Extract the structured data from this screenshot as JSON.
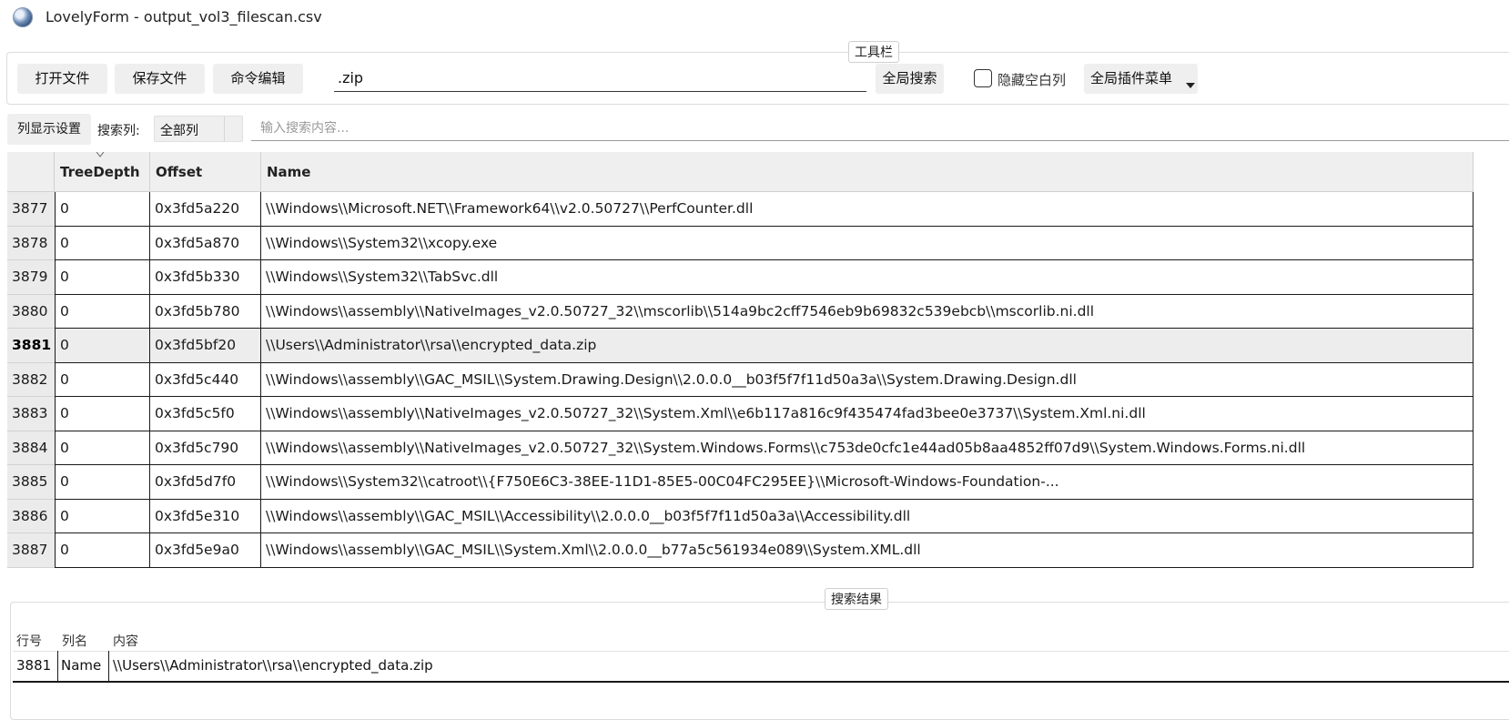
{
  "window": {
    "title": "LovelyForm - output_vol3_filescan.csv",
    "app_icon": "globe-icon"
  },
  "toolbar": {
    "legend": "工具栏",
    "open_file": "打开文件",
    "save_file": "保存文件",
    "command_edit": "命令编辑",
    "search_value": ".zip",
    "global_search": "全局搜索",
    "hide_blank_columns": "隐藏空白列",
    "hide_blank_checked": false,
    "global_plugin_menu": "全局插件菜单"
  },
  "filter": {
    "column_settings": "列显示设置",
    "search_column_label": "搜索列:",
    "search_column_value": "全部列",
    "search_placeholder": "输入搜索内容..."
  },
  "table": {
    "columns": [
      "TreeDepth",
      "Offset",
      "Name"
    ],
    "selected_row": "3881",
    "rows": [
      {
        "num": "3877",
        "depth": "0",
        "offset": "0x3fd5a220",
        "name": "\\\\Windows\\\\Microsoft.NET\\\\Framework64\\\\v2.0.50727\\\\PerfCounter.dll"
      },
      {
        "num": "3878",
        "depth": "0",
        "offset": "0x3fd5a870",
        "name": "\\\\Windows\\\\System32\\\\xcopy.exe"
      },
      {
        "num": "3879",
        "depth": "0",
        "offset": "0x3fd5b330",
        "name": "\\\\Windows\\\\System32\\\\TabSvc.dll"
      },
      {
        "num": "3880",
        "depth": "0",
        "offset": "0x3fd5b780",
        "name": "\\\\Windows\\\\assembly\\\\NativeImages_v2.0.50727_32\\\\mscorlib\\\\514a9bc2cff7546eb9b69832c539ebcb\\\\mscorlib.ni.dll"
      },
      {
        "num": "3881",
        "depth": "0",
        "offset": "0x3fd5bf20",
        "name": "\\\\Users\\\\Administrator\\\\rsa\\\\encrypted_data.zip"
      },
      {
        "num": "3882",
        "depth": "0",
        "offset": "0x3fd5c440",
        "name": "\\\\Windows\\\\assembly\\\\GAC_MSIL\\\\System.Drawing.Design\\\\2.0.0.0__b03f5f7f11d50a3a\\\\System.Drawing.Design.dll"
      },
      {
        "num": "3883",
        "depth": "0",
        "offset": "0x3fd5c5f0",
        "name": "\\\\Windows\\\\assembly\\\\NativeImages_v2.0.50727_32\\\\System.Xml\\\\e6b117a816c9f435474fad3bee0e3737\\\\System.Xml.ni.dll"
      },
      {
        "num": "3884",
        "depth": "0",
        "offset": "0x3fd5c790",
        "name": "\\\\Windows\\\\assembly\\\\NativeImages_v2.0.50727_32\\\\System.Windows.Forms\\\\c753de0cfc1e44ad05b8aa4852ff07d9\\\\System.Windows.Forms.ni.dll"
      },
      {
        "num": "3885",
        "depth": "0",
        "offset": "0x3fd5d7f0",
        "name": "\\\\Windows\\\\System32\\\\catroot\\\\{F750E6C3-38EE-11D1-85E5-00C04FC295EE}\\\\Microsoft-Windows-Foundation-..."
      },
      {
        "num": "3886",
        "depth": "0",
        "offset": "0x3fd5e310",
        "name": "\\\\Windows\\\\assembly\\\\GAC_MSIL\\\\Accessibility\\\\2.0.0.0__b03f5f7f11d50a3a\\\\Accessibility.dll"
      },
      {
        "num": "3887",
        "depth": "0",
        "offset": "0x3fd5e9a0",
        "name": "\\\\Windows\\\\assembly\\\\GAC_MSIL\\\\System.Xml\\\\2.0.0.0__b77a5c561934e089\\\\System.XML.dll"
      }
    ]
  },
  "results": {
    "legend": "搜索结果",
    "columns": [
      "行号",
      "列名",
      "内容"
    ],
    "rows": [
      {
        "line": "3881",
        "column": "Name",
        "content": "\\\\Users\\\\Administrator\\\\rsa\\\\encrypted_data.zip"
      }
    ]
  }
}
